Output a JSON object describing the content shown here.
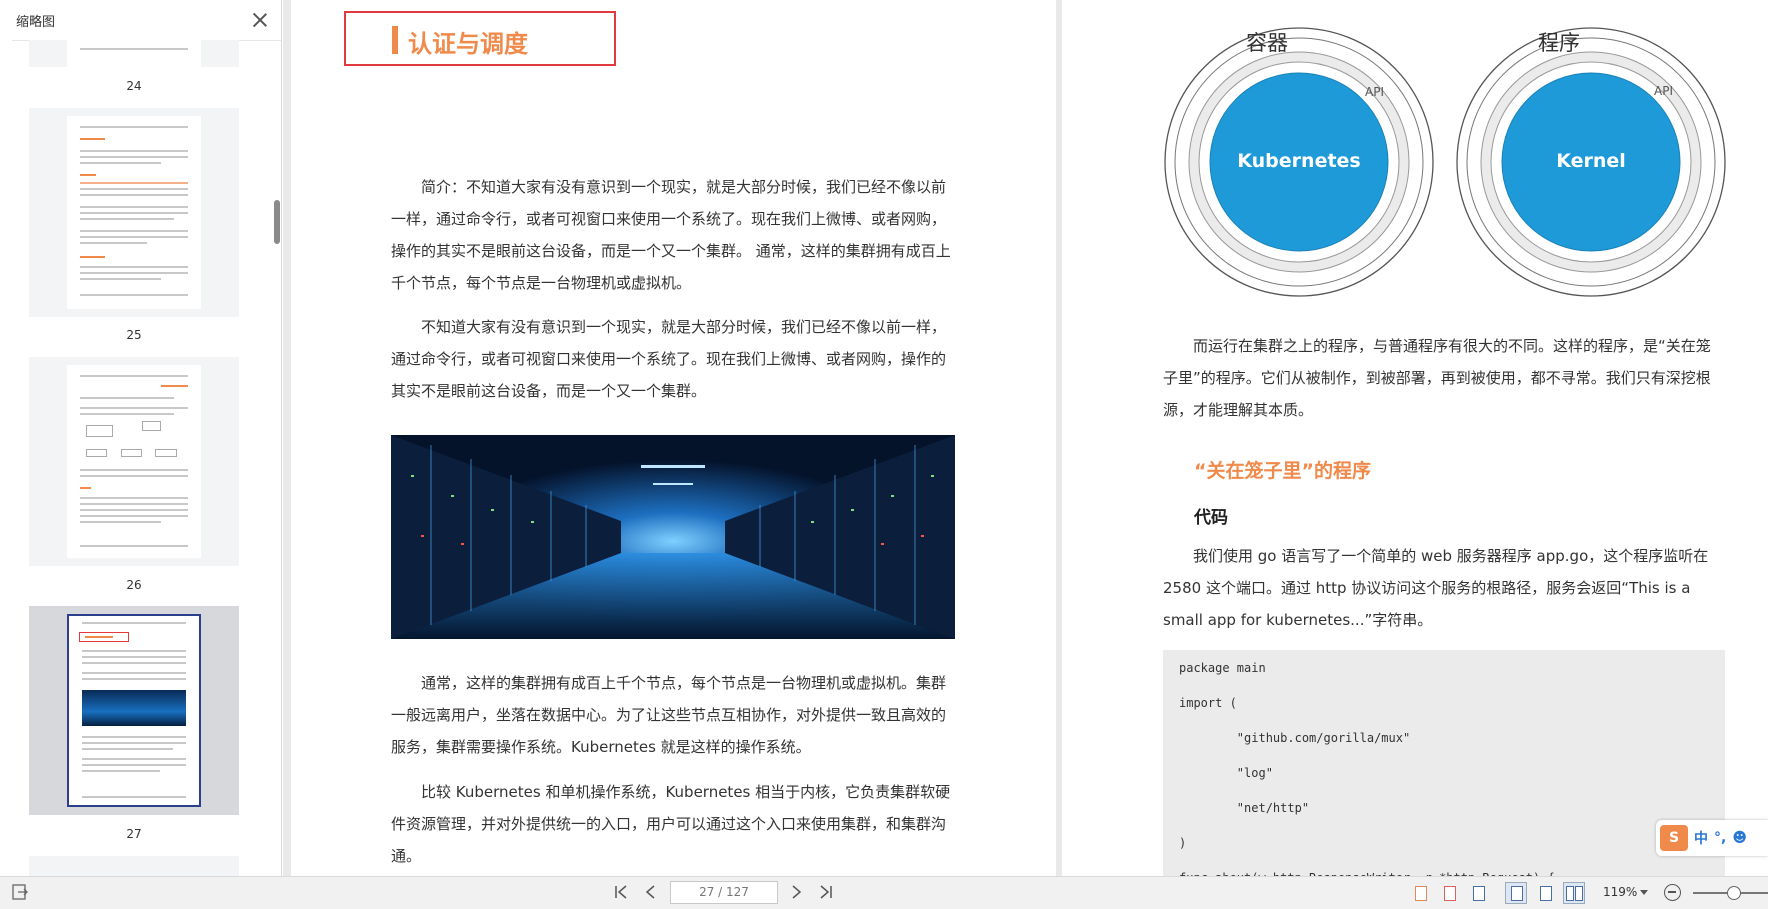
{
  "sidebar": {
    "title": "缩略图",
    "thumbnails": [
      {
        "page": "24",
        "active": false
      },
      {
        "page": "25",
        "active": false
      },
      {
        "page": "26",
        "active": false
      },
      {
        "page": "27",
        "active": true
      }
    ]
  },
  "left_page": {
    "chapter_title": "认证与调度",
    "paragraphs": [
      "简介：不知道大家有没有意识到一个现实，就是大部分时候，我们已经不像以前一样，通过命令行，或者可视窗口来使用一个系统了。现在我们上微博、或者网购，操作的其实不是眼前这台设备，而是一个又一个集群。 通常，这样的集群拥有成百上千个节点，每个节点是一台物理机或虚拟机。",
      "不知道大家有没有意识到一个现实，就是大部分时候，我们已经不像以前一样，通过命令行，或者可视窗口来使用一个系统了。现在我们上微博、或者网购，操作的其实不是眼前这台设备，而是一个又一个集群。",
      "通常，这样的集群拥有成百上千个节点，每个节点是一台物理机或虚拟机。集群一般远离用户，坐落在数据中心。为了让这些节点互相协作，对外提供一致且高效的服务，集群需要操作系统。Kubernetes 就是这样的操作系统。",
      "比较 Kubernetes 和单机操作系统，Kubernetes 相当于内核，它负责集群软硬件资源管理，并对外提供统一的入口，用户可以通过这个入口来使用集群，和集群沟通。"
    ]
  },
  "right_page": {
    "diagram": {
      "left": {
        "label": "容器",
        "api": "API",
        "core": "Kubernetes"
      },
      "right": {
        "label": "程序",
        "api": "API",
        "core": "Kernel"
      }
    },
    "intro_paragraph": "而运行在集群之上的程序，与普通程序有很大的不同。这样的程序，是“关在笼子里”的程序。它们从被制作，到被部署，再到被使用，都不寻常。我们只有深挖根源，才能理解其本质。",
    "section_title": "“关在笼子里”的程序",
    "sub_title": "代码",
    "code_paragraph": "我们使用 go 语言写了一个简单的 web 服务器程序 app.go，这个程序监听在 2580 这个端口。通过 http 协议访问这个服务的根路径，服务会返回“This is a small app for kubernetes...”字符串。",
    "code_lines": [
      "package main",
      "import (",
      "        \"github.com/gorilla/mux\"",
      "        \"log\"",
      "        \"net/http\"",
      ")",
      "func about(w http.ResponseWriter, r *http.Request) {"
    ]
  },
  "ime": {
    "logo": "S",
    "mode": "中",
    "punct": "°,",
    "emoji": "☻"
  },
  "statusbar": {
    "page_indicator": "27 / 127",
    "zoom": "119%",
    "zoom_fraction": 0.55
  },
  "colors": {
    "accent": "#f08a4b",
    "chapter_border": "#e0393e",
    "diagram_blue": "#1e9ad8"
  }
}
